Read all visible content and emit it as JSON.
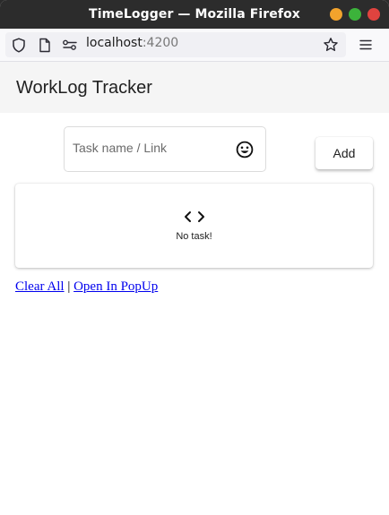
{
  "window": {
    "title": "TimeLogger — Mozilla Firefox"
  },
  "browser": {
    "url_host": "localhost",
    "url_port": ":4200",
    "icons": [
      "shield-icon",
      "page-icon",
      "permissions-icon",
      "bookmark-star-icon",
      "hamburger-menu-icon"
    ]
  },
  "app": {
    "title": "WorkLog Tracker",
    "task_input": {
      "placeholder": "Task name / Link",
      "value": ""
    },
    "add_label": "Add",
    "empty_state": {
      "icon": "code-icon",
      "text": "No task!"
    },
    "links": {
      "clear_all": "Clear All",
      "separator": " | ",
      "open_popup": "Open In PopUp"
    }
  },
  "colors": {
    "titlebar_bg": "#2c2c2c",
    "minimize": "#f2a32c",
    "maximize": "#3cb33b",
    "close": "#e0433f",
    "header_bg": "#f5f5f5",
    "link": "#0000ee"
  }
}
